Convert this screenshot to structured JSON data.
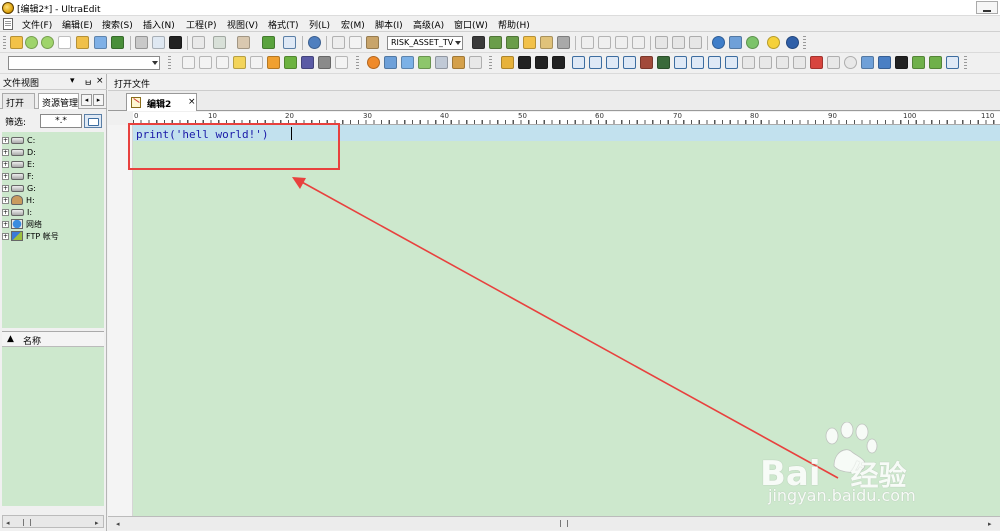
{
  "window": {
    "title": "[编辑2*] - UltraEdit"
  },
  "menu": {
    "items": [
      "文件(F)",
      "编辑(E)",
      "搜索(S)",
      "插入(N)",
      "工程(P)",
      "视图(V)",
      "格式(T)",
      "列(L)",
      "宏(M)",
      "脚本(I)",
      "高级(A)",
      "窗口(W)",
      "帮助(H)"
    ]
  },
  "toolbar": {
    "config_combo_value": "RISK_ASSET_TV",
    "find_combo_value": ""
  },
  "left_panel": {
    "title": "文件视图",
    "pin_glyph": "ㅂ",
    "close_glyph": "×",
    "menu_glyph": "▾",
    "tabs": [
      "打开",
      "资源管理"
    ],
    "filter_label": "筛选:",
    "filter_value": "*.*",
    "tree_items": [
      "C:",
      "D:",
      "E:",
      "F:",
      "G:",
      "H:",
      "I:",
      "网络",
      "FTP 帐号"
    ],
    "list_header_sort": "▲",
    "list_header_name": "名称"
  },
  "editor": {
    "open_files_title": "打开文件",
    "tab_label": "编辑2",
    "tab_close": "×",
    "ruler_marks": [
      "0",
      "10",
      "20",
      "30",
      "40",
      "50",
      "60",
      "70",
      "80",
      "90",
      "100",
      "110"
    ],
    "code_line": "print('hell world!')"
  },
  "watermark": {
    "brand": "Bai",
    "brand_suffix": "经验",
    "url": "jingyan.baidu.com"
  },
  "colors": {
    "editor_bg": "#cde8cd",
    "current_line": "#c2e1ee",
    "code_text": "#1a1aa8",
    "annotation": "#e8413e"
  }
}
